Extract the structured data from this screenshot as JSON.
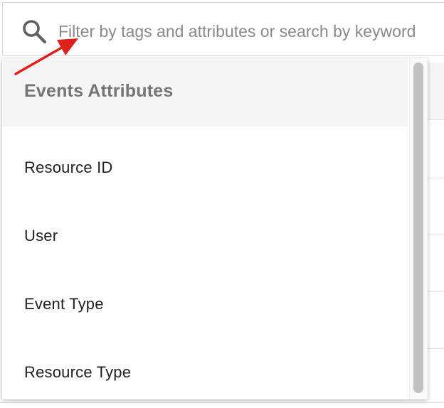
{
  "search": {
    "placeholder": "Filter by tags and attributes or search by keyword",
    "value": "",
    "icon": "search-icon"
  },
  "annotation": {
    "color": "#e0201b",
    "icon": "arrow-icon"
  },
  "dropdown": {
    "header": "Events Attributes",
    "options": [
      {
        "label": "Resource ID"
      },
      {
        "label": "User"
      },
      {
        "label": "Event Type"
      },
      {
        "label": "Resource Type"
      }
    ]
  }
}
